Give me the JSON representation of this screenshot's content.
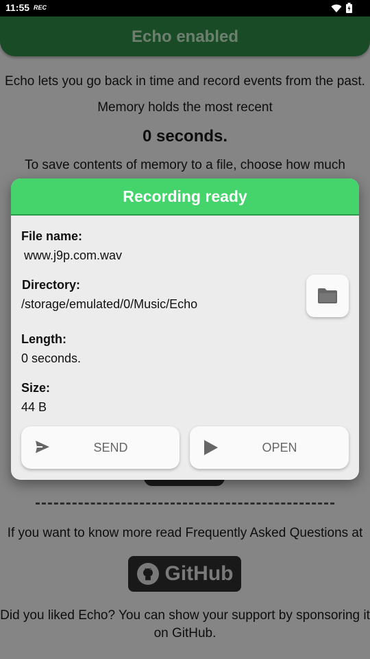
{
  "status_bar": {
    "time": "11:55",
    "rec": "REC"
  },
  "app": {
    "header_title": "Echo enabled",
    "intro": "Echo lets you go back in time and record events from the past.",
    "memory_label": "Memory holds the most recent",
    "memory_value": "0 seconds.",
    "save_hint": "To save contents of memory to a file, choose how much",
    "faq_text": "If you want to know more read Frequently Asked Questions at",
    "github_label": "GitHub",
    "support_text_line1": "Did you liked Echo? You can show your support by sponsoring it",
    "support_text_line2": "on GitHub."
  },
  "dialog": {
    "title": "Recording ready",
    "file_name_label": "File name:",
    "file_name_value": "www.j9p.com.wav",
    "directory_label": "Directory:",
    "directory_value": "/storage/emulated/0/Music/Echo",
    "length_label": "Length:",
    "length_value": "0 seconds.",
    "size_label": "Size:",
    "size_value": "44 B",
    "send_label": "SEND",
    "open_label": "OPEN"
  },
  "colors": {
    "dialog_header": "#45d46c",
    "app_header": "#2f8a45",
    "scrim": "rgba(0,0,0,0.45)"
  },
  "icons": {
    "wifi": "wifi-icon",
    "battery": "battery-icon",
    "folder": "folder-icon",
    "send": "send-icon",
    "play": "play-icon",
    "github": "github-icon"
  }
}
